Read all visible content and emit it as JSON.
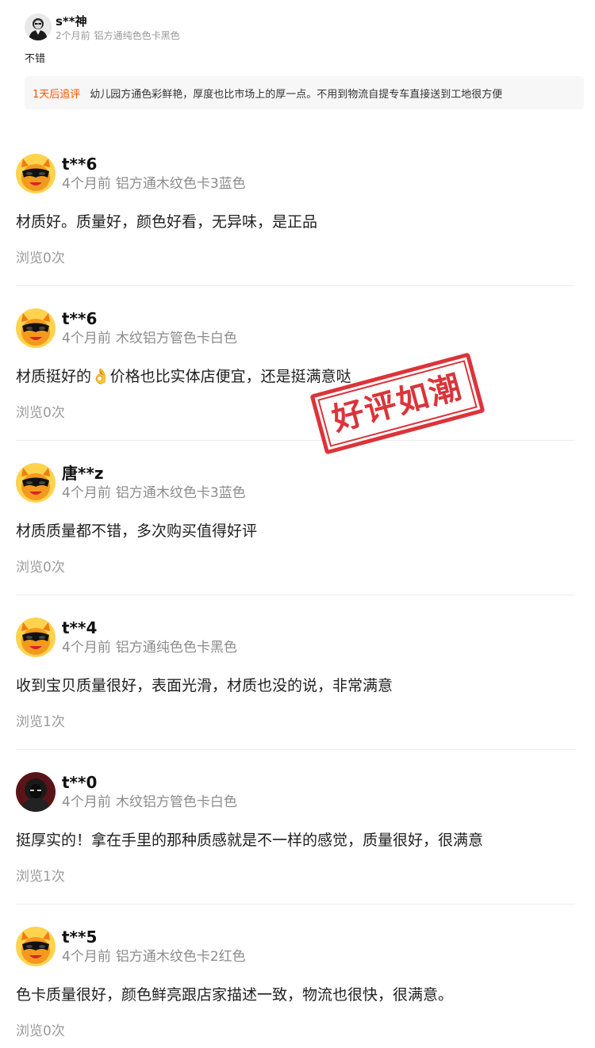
{
  "top_review": {
    "user": "s**神",
    "time": "2个月前",
    "sku": "铝方通纯色色卡黑色",
    "content": "不错",
    "followup_tag": "1天后追评",
    "followup_text": "幼儿园方通色彩鲜艳，厚度也比市场上的厚一点。不用到物流自提专车直接送到工地很方便"
  },
  "reviews": [
    {
      "user": "t**6",
      "time": "4个月前",
      "sku": "铝方通木纹色卡3蓝色",
      "content": "材质好。质量好，颜色好看，无异味，是正品",
      "views": "浏览0次",
      "avatar_icon": "cartoon-mascot-avatar-icon"
    },
    {
      "user": "t**6",
      "time": "4个月前",
      "sku": "木纹铝方管色卡白色",
      "content": "材质挺好的👌价格也比实体店便宜，还是挺满意哒",
      "views": "浏览0次",
      "avatar_icon": "cartoon-mascot-avatar-icon"
    },
    {
      "user": "唐**z",
      "time": "4个月前",
      "sku": "铝方通木纹色卡3蓝色",
      "content": "材质质量都不错，多次购买值得好评",
      "views": "浏览0次",
      "avatar_icon": "cartoon-mascot-avatar-icon"
    },
    {
      "user": "t**4",
      "time": "4个月前",
      "sku": "铝方通纯色色卡黑色",
      "content": "收到宝贝质量很好，表面光滑，材质也没的说，非常满意",
      "views": "浏览1次",
      "avatar_icon": "cartoon-mascot-avatar-icon"
    },
    {
      "user": "t**0",
      "time": "4个月前",
      "sku": "木纹铝方管色卡白色",
      "content": "挺厚实的！拿在手里的那种质感就是不一样的感觉，质量很好，很满意",
      "views": "浏览1次",
      "avatar_icon": "hooded-figure-avatar-icon"
    },
    {
      "user": "t**5",
      "time": "4个月前",
      "sku": "铝方通木纹色卡2红色",
      "content": "色卡质量很好，颜色鲜亮跟店家描述一致，物流也很快，很满意。",
      "views": "浏览0次",
      "avatar_icon": "cartoon-mascot-avatar-icon"
    }
  ],
  "stamp": {
    "text": "好评如潮",
    "color": "#d8232a"
  },
  "colors": {
    "followup_accent": "#ff5000",
    "meta_gray": "#8c8c8c",
    "mascot_orange": "#f39a1e"
  }
}
